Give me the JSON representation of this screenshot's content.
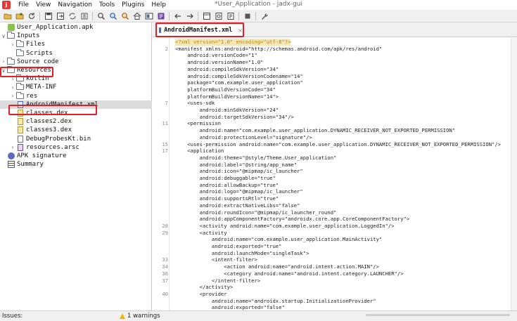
{
  "window": {
    "title": "*User_Application - jadx-gui"
  },
  "menu": [
    "File",
    "View",
    "Navigation",
    "Tools",
    "Plugins",
    "Help"
  ],
  "toolbar": {
    "icons": [
      "open-icon",
      "add-files-icon",
      "reload-icon",
      "save-icon",
      "export-icon",
      "sync-icon",
      "flatten-icon",
      "search-text-icon",
      "search-class-icon",
      "usage-icon",
      "home-icon",
      "deobfuscation-icon",
      "log-icon",
      "back-icon",
      "forward-icon",
      "quick-tabs-icon",
      "bookmark-icon",
      "quark-icon",
      "stop-icon",
      "preferences-icon"
    ]
  },
  "tree": {
    "items": [
      {
        "label": "User_Application.apk",
        "level": 0,
        "chevron": "",
        "icon": "apk",
        "selected": false
      },
      {
        "label": "Inputs",
        "level": 0,
        "chevron": "∨",
        "icon": "folder",
        "selected": false
      },
      {
        "label": "Files",
        "level": 1,
        "chevron": "›",
        "icon": "folder",
        "selected": false
      },
      {
        "label": "Scripts",
        "level": 1,
        "chevron": "",
        "icon": "folder",
        "selected": false
      },
      {
        "label": "Source code",
        "level": 0,
        "chevron": "›",
        "icon": "folder",
        "selected": false
      },
      {
        "label": "Resources",
        "level": 0,
        "chevron": "∨",
        "icon": "folder",
        "selected": false
      },
      {
        "label": "kotlin",
        "level": 1,
        "chevron": "›",
        "icon": "folder",
        "selected": false
      },
      {
        "label": "META-INF",
        "level": 1,
        "chevron": "›",
        "icon": "folder",
        "selected": false
      },
      {
        "label": "res",
        "level": 1,
        "chevron": "›",
        "icon": "folder",
        "selected": false
      },
      {
        "label": "AndroidManifest.xml",
        "level": 1,
        "chevron": "",
        "icon": "xml",
        "selected": true
      },
      {
        "label": "classes.dex",
        "level": 1,
        "chevron": "",
        "icon": "dex",
        "selected": false
      },
      {
        "label": "classes2.dex",
        "level": 1,
        "chevron": "",
        "icon": "dex",
        "selected": false
      },
      {
        "label": "classes3.dex",
        "level": 1,
        "chevron": "",
        "icon": "dex",
        "selected": false
      },
      {
        "label": "DebugProbesKt.bin",
        "level": 1,
        "chevron": "",
        "icon": "file",
        "selected": false
      },
      {
        "label": "resources.arsc",
        "level": 1,
        "chevron": "›",
        "icon": "arsc",
        "selected": false
      },
      {
        "label": "APK signature",
        "level": 0,
        "chevron": "",
        "icon": "sig",
        "selected": false
      },
      {
        "label": "Summary",
        "level": 0,
        "chevron": "",
        "icon": "sum",
        "selected": false
      }
    ]
  },
  "editor": {
    "tab_label": "AndroidManifest.xml",
    "tab_close": "×",
    "lines": [
      {
        "n": "",
        "text": "<?xml version=\"1.0\" encoding=\"utf-8\"?>",
        "kind": "decl"
      },
      {
        "n": "2",
        "text": "<manifest xmlns:android=\"http://schemas.android.com/apk/res/android\"",
        "kind": ""
      },
      {
        "n": "",
        "text": "    android:versionCode=\"1\"",
        "kind": ""
      },
      {
        "n": "",
        "text": "    android:versionName=\"1.0\"",
        "kind": ""
      },
      {
        "n": "",
        "text": "    android:compileSdkVersion=\"34\"",
        "kind": ""
      },
      {
        "n": "",
        "text": "    android:compileSdkVersionCodename=\"14\"",
        "kind": ""
      },
      {
        "n": "",
        "text": "    package=\"com.example.user_application\"",
        "kind": ""
      },
      {
        "n": "",
        "text": "    platformBuildVersionCode=\"34\"",
        "kind": ""
      },
      {
        "n": "",
        "text": "    platformBuildVersionName=\"14\">",
        "kind": ""
      },
      {
        "n": "7",
        "text": "    <uses-sdk",
        "kind": ""
      },
      {
        "n": "",
        "text": "        android:minSdkVersion=\"24\"",
        "kind": ""
      },
      {
        "n": "",
        "text": "        android:targetSdkVersion=\"34\"/>",
        "kind": ""
      },
      {
        "n": "11",
        "text": "    <permission",
        "kind": ""
      },
      {
        "n": "",
        "text": "        android:name=\"com.example.user_application.DYNAMIC_RECEIVER_NOT_EXPORTED_PERMISSION\"",
        "kind": ""
      },
      {
        "n": "",
        "text": "        android:protectionLevel=\"signature\"/>",
        "kind": ""
      },
      {
        "n": "15",
        "text": "    <uses-permission android:name=\"com.example.user_application.DYNAMIC_RECEIVER_NOT_EXPORTED_PERMISSION\"/>",
        "kind": ""
      },
      {
        "n": "17",
        "text": "    <application",
        "kind": ""
      },
      {
        "n": "",
        "text": "        android:theme=\"@style/Theme.User_application\"",
        "kind": ""
      },
      {
        "n": "",
        "text": "        android:label=\"@string/app_name\"",
        "kind": ""
      },
      {
        "n": "",
        "text": "        android:icon=\"@mipmap/ic_launcher\"",
        "kind": ""
      },
      {
        "n": "",
        "text": "        android:debuggable=\"true\"",
        "kind": ""
      },
      {
        "n": "",
        "text": "        android:allowBackup=\"true\"",
        "kind": ""
      },
      {
        "n": "",
        "text": "        android:logo=\"@mipmap/ic_launcher\"",
        "kind": ""
      },
      {
        "n": "",
        "text": "        android:supportsRtl=\"true\"",
        "kind": ""
      },
      {
        "n": "",
        "text": "        android:extractNativeLibs=\"false\"",
        "kind": ""
      },
      {
        "n": "",
        "text": "        android:roundIcon=\"@mipmap/ic_launcher_round\"",
        "kind": ""
      },
      {
        "n": "",
        "text": "        android:appComponentFactory=\"androidx.core.app.CoreComponentFactory\">",
        "kind": ""
      },
      {
        "n": "28",
        "text": "        <activity android:name=\"com.example.user_application.LoggedIn\"/>",
        "kind": ""
      },
      {
        "n": "29",
        "text": "        <activity",
        "kind": ""
      },
      {
        "n": "",
        "text": "            android:name=\"com.example.user_application.MainActivity\"",
        "kind": ""
      },
      {
        "n": "",
        "text": "            android:exported=\"true\"",
        "kind": ""
      },
      {
        "n": "",
        "text": "            android:launchMode=\"singleTask\">",
        "kind": ""
      },
      {
        "n": "33",
        "text": "            <intent-filter>",
        "kind": ""
      },
      {
        "n": "34",
        "text": "                <action android:name=\"android.intent.action.MAIN\"/>",
        "kind": ""
      },
      {
        "n": "36",
        "text": "                <category android:name=\"android.intent.category.LAUNCHER\"/>",
        "kind": ""
      },
      {
        "n": "37",
        "text": "            </intent-filter>",
        "kind": ""
      },
      {
        "n": "",
        "text": "        </activity>",
        "kind": ""
      },
      {
        "n": "40",
        "text": "        <provider",
        "kind": ""
      },
      {
        "n": "",
        "text": "            android:name=\"androidx.startup.InitializationProvider\"",
        "kind": ""
      },
      {
        "n": "",
        "text": "            android:exported=\"false\"",
        "kind": ""
      }
    ]
  },
  "status": {
    "issues_label": "Issues:",
    "warnings": "1 warnings"
  },
  "colors": {
    "highlight": "#e21f26",
    "selected_row": "#dcdcdc",
    "xml_decl_bg": "#f6e6b4"
  }
}
